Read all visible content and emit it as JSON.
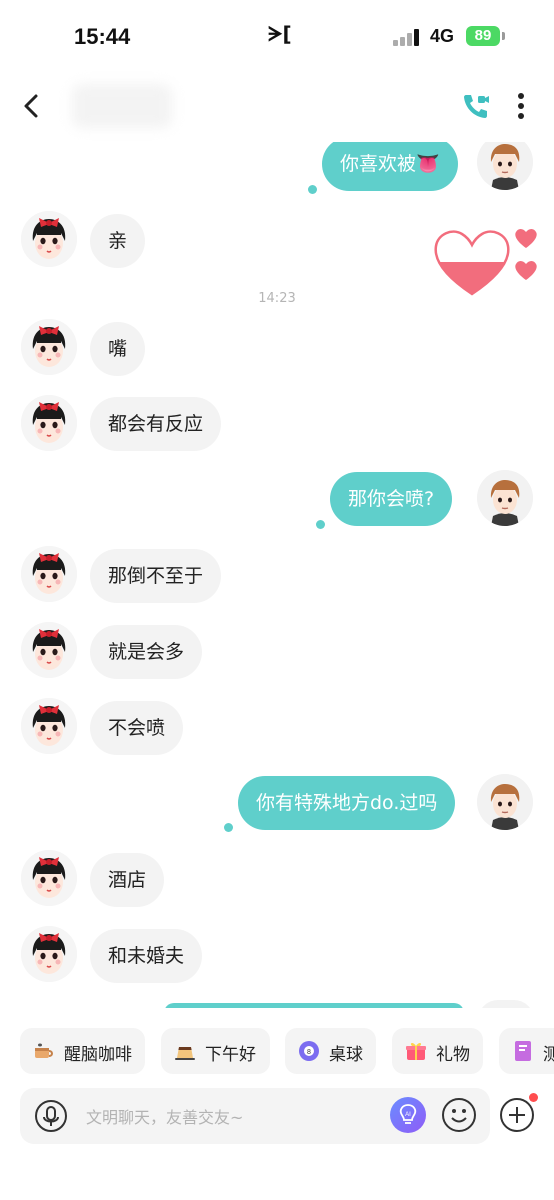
{
  "status_bar": {
    "time": "15:44",
    "middle_glyph": "ᗒ[",
    "network": "4G",
    "battery": "89"
  },
  "nav": {
    "back_icon": "chevron-left-icon",
    "call_icon": "video-call-icon",
    "more_icon": "more-vertical-icon"
  },
  "messages": [
    {
      "side": "right",
      "text": "你喜欢被👅"
    },
    {
      "side": "left",
      "text": "亲"
    },
    {
      "side": "left",
      "text": "嘴"
    },
    {
      "side": "left",
      "text": "都会有反应"
    },
    {
      "side": "right",
      "text": "那你会喷?"
    },
    {
      "side": "left",
      "text": "那倒不至于"
    },
    {
      "side": "left",
      "text": "就是会多"
    },
    {
      "side": "left",
      "text": "不会喷"
    },
    {
      "side": "right",
      "text": "你有特殊地方do.过吗"
    },
    {
      "side": "left",
      "text": "酒店"
    },
    {
      "side": "left",
      "text": "和未婚夫"
    }
  ],
  "timestamp": "14:23",
  "quick_bar": [
    {
      "label": "醒脑咖啡",
      "icon": "coffee-icon"
    },
    {
      "label": "下午好",
      "icon": "pudding-icon"
    },
    {
      "label": "桌球",
      "icon": "billiard-ball-icon"
    },
    {
      "label": "礼物",
      "icon": "gift-icon"
    },
    {
      "label": "测",
      "icon": "book-icon"
    }
  ],
  "input": {
    "placeholder": "文明聊天，友善交友~"
  },
  "colors": {
    "accent": "#5fcfcb",
    "bubble_left": "#f3f3f3",
    "heart": "#f26d7d"
  }
}
